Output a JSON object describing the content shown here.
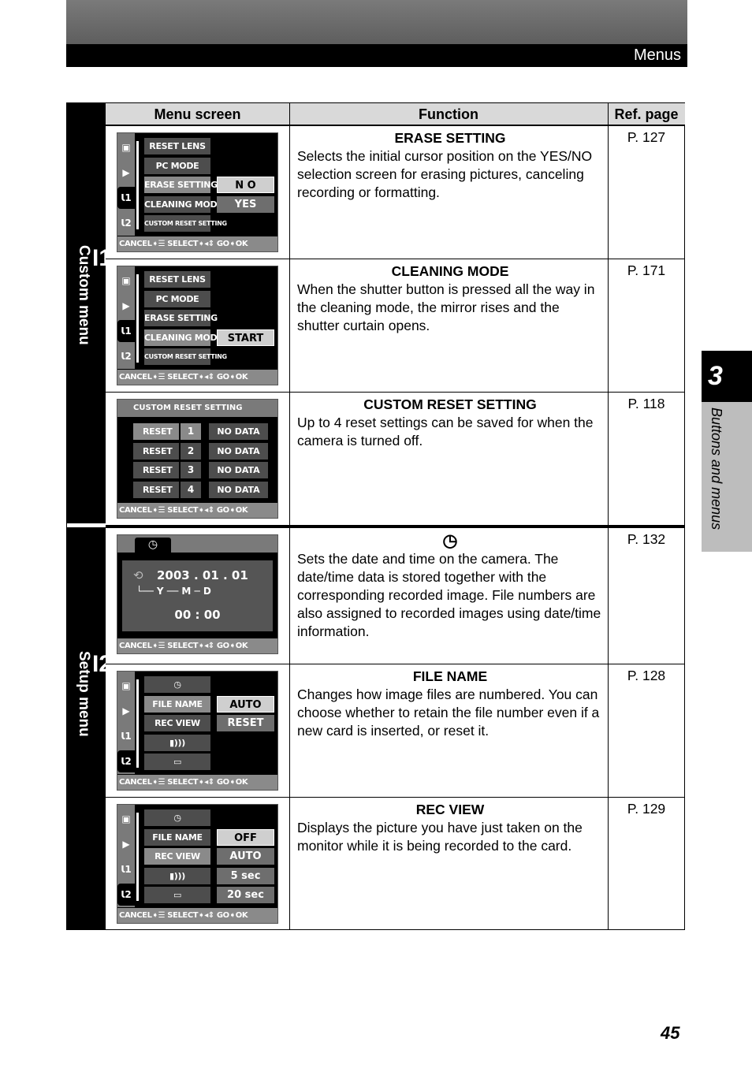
{
  "header": {
    "title": "Menus"
  },
  "table": {
    "headers": [
      "Menu screen",
      "Function",
      "Ref. page"
    ]
  },
  "sections": [
    {
      "icon": "wrench-1-icon",
      "num": "1",
      "label": "Custom menu"
    },
    {
      "icon": "wrench-2-icon",
      "num": "2",
      "label": "Setup menu"
    }
  ],
  "bottom_bar": "CANCEL➧☰ SELECT➧◂⇕ GO➧OK",
  "rows": [
    {
      "title": "ERASE SETTING",
      "desc": "Selects the initial cursor position on the YES/NO selection screen for erasing pictures, canceling recording or formatting.",
      "ref": "P. 127",
      "screen": {
        "type": "menu",
        "active_tab": 2,
        "items": [
          "RESET LENS",
          "PC MODE",
          "ERASE SETTING",
          "CLEANING MODE",
          "CUSTOM RESET SETTING"
        ],
        "selected_item": 2,
        "options": [
          null,
          null,
          "N O",
          "YES",
          null
        ],
        "selected_option": 2
      }
    },
    {
      "title": "CLEANING MODE",
      "desc": "When the shutter button is pressed all the way in the cleaning mode, the mirror rises and the shutter curtain opens.",
      "ref": "P. 171",
      "screen": {
        "type": "menu",
        "active_tab": 2,
        "items": [
          "RESET LENS",
          "PC MODE",
          "ERASE SETTING",
          "CLEANING MODE",
          "CUSTOM RESET SETTING"
        ],
        "selected_item": 3,
        "options": [
          null,
          null,
          null,
          "START",
          null
        ],
        "selected_option": 3
      }
    },
    {
      "title": "CUSTOM RESET SETTING",
      "desc": "Up to 4 reset settings can be saved for when the camera is turned off.",
      "ref": "P. 118",
      "screen": {
        "type": "reset",
        "heading": "CUSTOM RESET SETTING",
        "resets": [
          {
            "label": "RESET",
            "n": "1",
            "value": "NO DATA"
          },
          {
            "label": "RESET",
            "n": "2",
            "value": "NO DATA"
          },
          {
            "label": "RESET",
            "n": "3",
            "value": "NO DATA"
          },
          {
            "label": "RESET",
            "n": "4",
            "value": "NO DATA"
          }
        ]
      }
    },
    {
      "title": "◷",
      "title_icon": "clock-icon",
      "desc": "Sets the date and time on the camera. The date/time data is stored together with the corresponding recorded image. File numbers are also assigned to recorded images using date/time information.",
      "ref": "P. 132",
      "screen": {
        "type": "date",
        "tab": "◷",
        "date": "2003 . 01 . 01",
        "ymd": "└── Y ── M ─ D",
        "time": "00 : 00"
      }
    },
    {
      "title": "FILE NAME",
      "desc": "Changes how image files are numbered. You can choose whether to retain the file number even if a new card is inserted, or reset it.",
      "ref": "P. 128",
      "screen": {
        "type": "menu",
        "active_tab": 3,
        "items": [
          "◷",
          "FILE NAME",
          "REC VIEW",
          "▮)))",
          "▭"
        ],
        "selected_item": 1,
        "options": [
          null,
          "AUTO",
          "RESET",
          null,
          null
        ],
        "selected_option": 1
      }
    },
    {
      "title": "REC VIEW",
      "desc": "Displays the picture you have just taken on the monitor while it is being recorded to the card.",
      "ref": "P. 129",
      "screen": {
        "type": "menu",
        "active_tab": 3,
        "items": [
          "◷",
          "FILE NAME",
          "REC VIEW",
          "▮)))",
          "▭"
        ],
        "selected_item": 2,
        "options": [
          null,
          "OFF",
          "AUTO",
          "5 sec",
          "20 sec"
        ],
        "selected_option": 1
      }
    }
  ],
  "side_tab": {
    "chapter": "3",
    "label": "Buttons and menus"
  },
  "page_number": "45"
}
